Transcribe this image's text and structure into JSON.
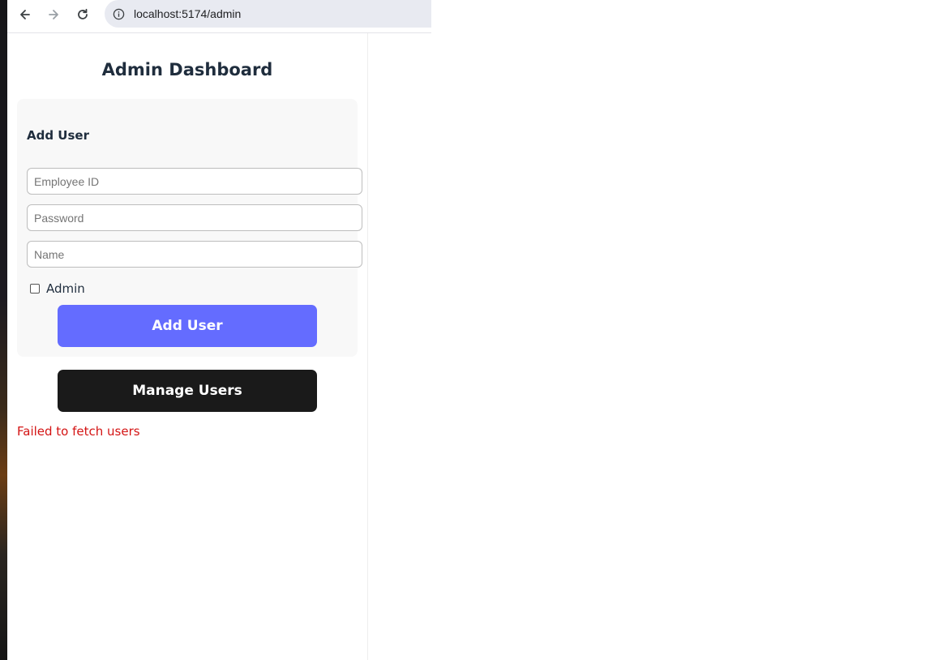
{
  "browser": {
    "url": "localhost:5174/admin",
    "icons": {
      "back": "back-arrow-icon",
      "forward": "forward-arrow-icon",
      "reload": "reload-icon",
      "site_info": "info-icon"
    }
  },
  "page": {
    "title": "Admin Dashboard"
  },
  "add_user_form": {
    "title": "Add User",
    "employee_id": {
      "value": "",
      "placeholder": "Employee ID"
    },
    "password": {
      "value": "",
      "placeholder": "Password"
    },
    "name": {
      "value": "",
      "placeholder": "Name"
    },
    "admin_checkbox": {
      "label": "Admin",
      "checked": false
    },
    "submit_label": "Add User"
  },
  "manage_users_label": "Manage Users",
  "status": {
    "error": "Failed to fetch users"
  },
  "colors": {
    "primary_button": "#646cff",
    "dark_button": "#1a1a1a",
    "error": "#d41414",
    "heading": "#1f2d3d"
  }
}
